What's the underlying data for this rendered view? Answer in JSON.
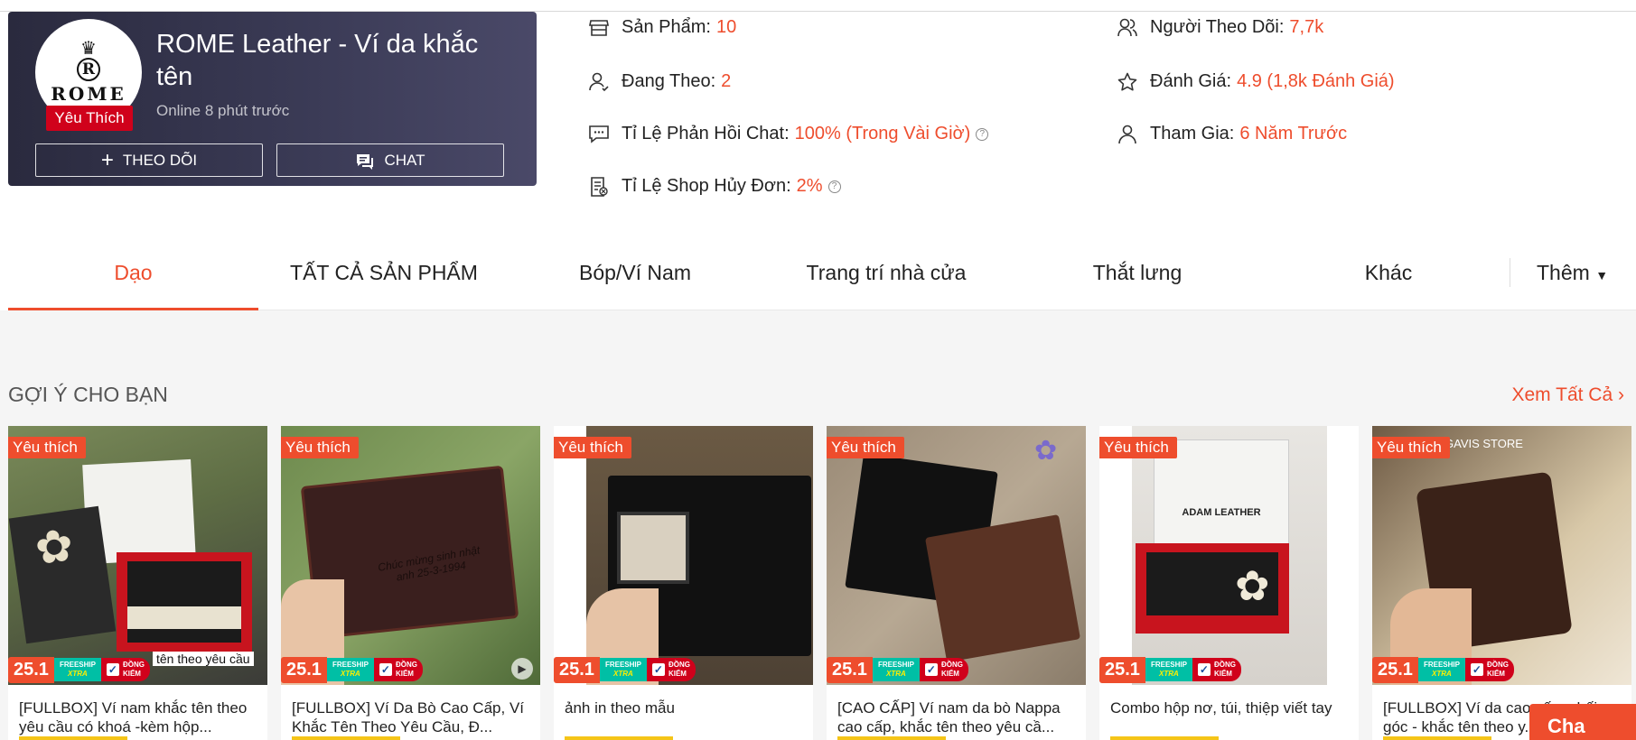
{
  "shop": {
    "name": "ROME Leather - Ví da khắc tên",
    "online": "Online 8 phút trước",
    "badge": "Yêu Thích",
    "logo_text": "ROME",
    "logo_letter": "R",
    "follow_label": "THEO DÕI",
    "chat_label": "CHAT"
  },
  "stats": [
    {
      "icon": "store-icon",
      "label": "Sản Phẩm:",
      "value": "10"
    },
    {
      "icon": "user-check-icon",
      "label": "Đang Theo:",
      "value": "2"
    },
    {
      "icon": "chat-reply-icon",
      "label": "Tỉ Lệ Phản Hồi Chat:",
      "value": "100% (Trong Vài Giờ)"
    },
    {
      "icon": "order-cancel-icon",
      "label": "Tỉ Lệ Shop Hủy Đơn:",
      "value": "2%"
    },
    {
      "icon": "followers-icon",
      "label": "Người Theo Dõi:",
      "value": "7,7k"
    },
    {
      "icon": "star-icon",
      "label": "Đánh Giá:",
      "value": "4.9 (1,8k Đánh Giá)"
    },
    {
      "icon": "user-join-icon",
      "label": "Tham Gia:",
      "value": "6 Năm Trước"
    }
  ],
  "tabs": [
    "Dạo",
    "TẤT CẢ SẢN PHẨM",
    "Bóp/Ví Nam",
    "Trang trí nhà cửa",
    "Thắt lưng",
    "Khác"
  ],
  "tab_more": "Thêm",
  "section": {
    "title": "GỢI Ý CHO BẠN",
    "see_all": "Xem Tất Cả"
  },
  "promo": {
    "date": "25.1",
    "freeship": "FREESHIP",
    "xtra": "XTRA",
    "dongkiem1": "ĐỒNG",
    "dongkiem2": "KIỂM"
  },
  "products": [
    {
      "badge": "Yêu thích",
      "title": "[FULLBOX] Ví nam khắc tên theo yêu cầu có khoá -kèm hộp...",
      "caption": "tên theo yêu cầu"
    },
    {
      "badge": "Yêu thích",
      "title": "[FULLBOX] Ví Da Bò Cao Cấp, Ví Khắc Tên Theo Yêu Cầu, Đ...",
      "caption": "Chúc mừng sinh nhật anh 25-3-1994"
    },
    {
      "badge": "Yêu thích",
      "title": "ảnh in theo mẫu",
      "caption": ""
    },
    {
      "badge": "Yêu thích",
      "title": "[CAO CẤP] Ví nam da bò Nappa cao cấp, khắc tên theo yêu cầ...",
      "caption": ""
    },
    {
      "badge": "Yêu thích",
      "title": "Combo hộp nơ, túi, thiệp viết tay",
      "caption": "ADAM LEATHER"
    },
    {
      "badge": "Yêu thích",
      "title": "[FULLBOX] Ví da cao cấp, phối góc - khắc tên theo y...",
      "caption": "GAVIS STORE"
    }
  ],
  "chat_float": "Cha",
  "colors": {
    "accent": "#ee4d2d",
    "card_bg": "#2a2a3e",
    "section_bg": "#f5f5f5"
  }
}
